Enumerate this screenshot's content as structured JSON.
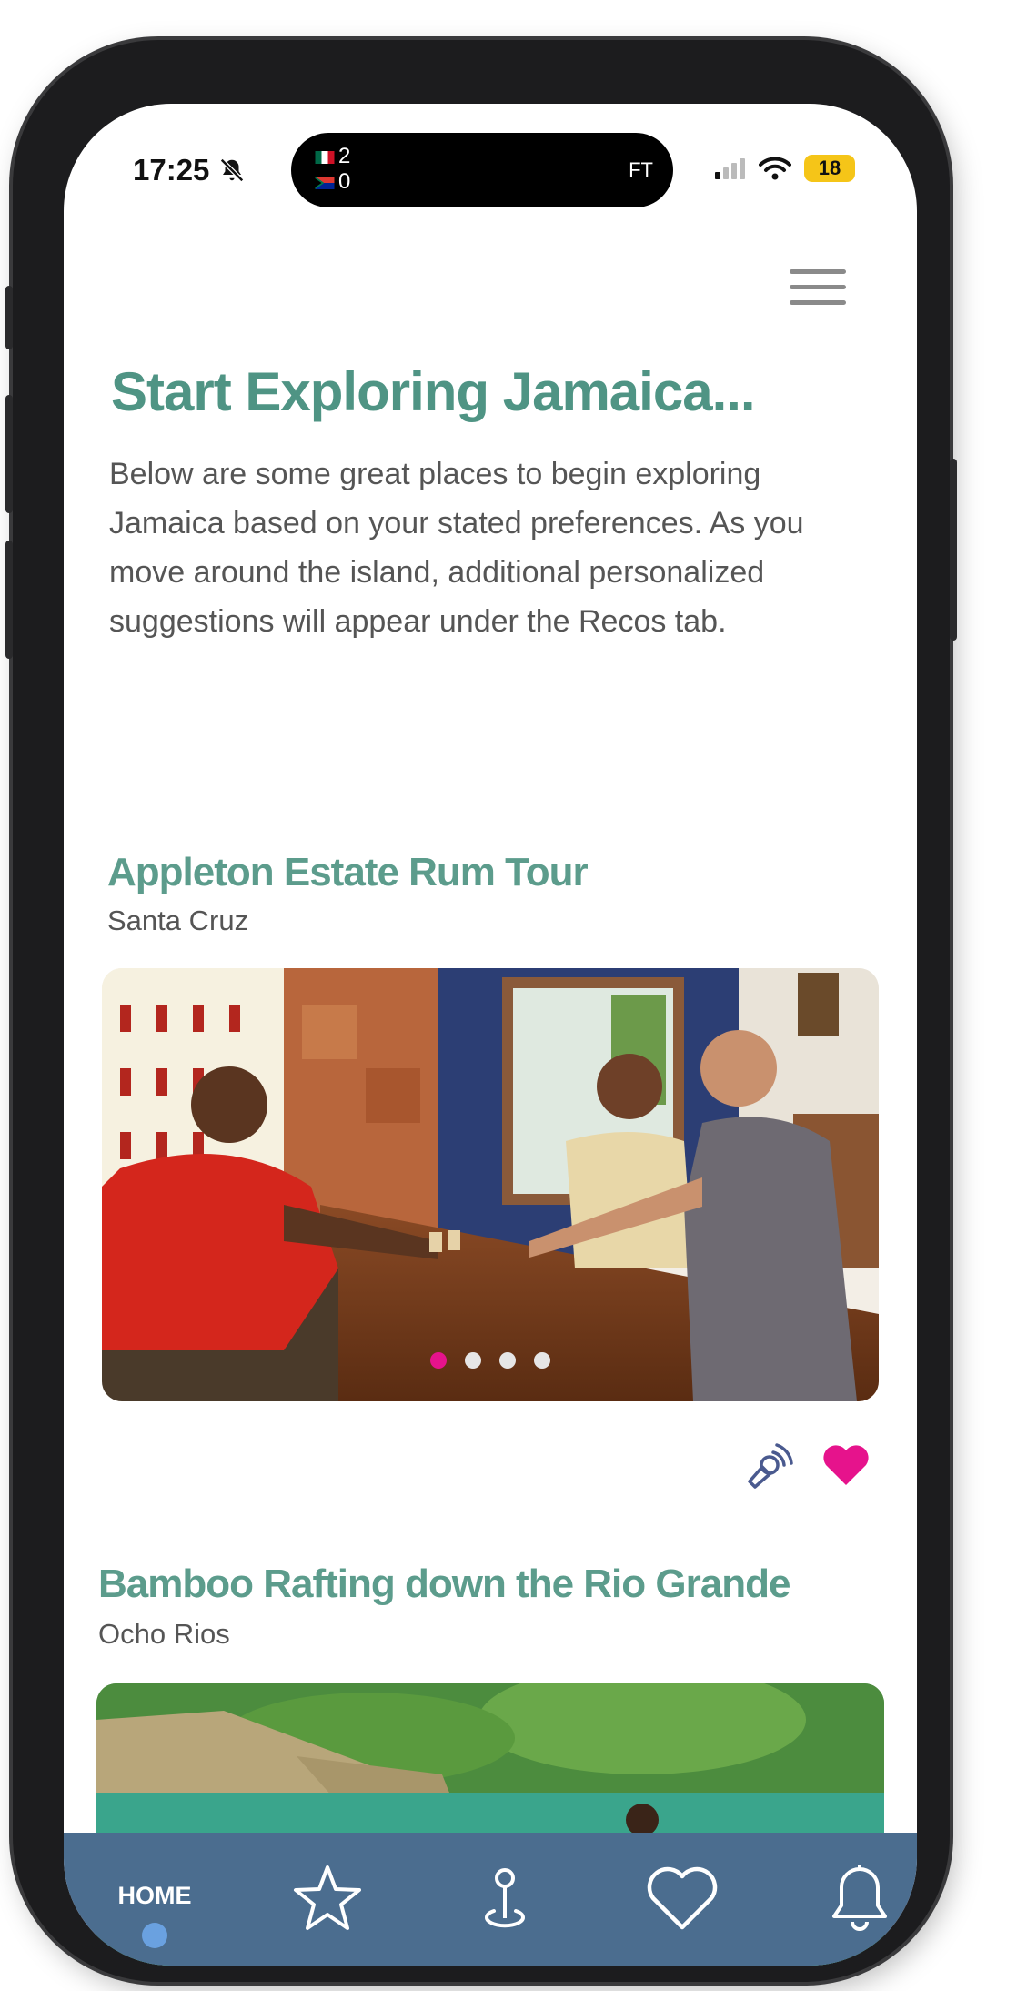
{
  "status_bar": {
    "time": "17:25",
    "live_scores": [
      {
        "team_flag": "mexico-flag",
        "score": "2"
      },
      {
        "team_flag": "south-africa-flag",
        "score": "0"
      }
    ],
    "match_status": "FT",
    "battery": "18"
  },
  "header": {
    "title": "Start Exploring Jamaica...",
    "intro": "Below are some great places to begin exploring Jamaica based on your stated preferences. As you move around the island, additional personalized suggestions will appear under the Recos tab."
  },
  "cards": [
    {
      "title": "Appleton Estate Rum Tour",
      "location": "Santa Cruz",
      "image_index": 0,
      "image_count": 4,
      "favorited": true
    },
    {
      "title": "Bamboo Rafting down the Rio Grande",
      "location": "Ocho Rios"
    }
  ],
  "bottom_nav": {
    "items": [
      {
        "label": "HOME",
        "icon": "home"
      },
      {
        "icon": "star-icon"
      },
      {
        "icon": "location-pin-icon"
      },
      {
        "icon": "heart-icon"
      },
      {
        "icon": "bell-icon"
      }
    ]
  },
  "colors": {
    "title": "#4f9484",
    "accent_pink": "#e6138c",
    "nav_background": "#4b6d8f",
    "nav_active_dot": "#6aa1e0",
    "audio_icon": "#4a5a8f"
  }
}
